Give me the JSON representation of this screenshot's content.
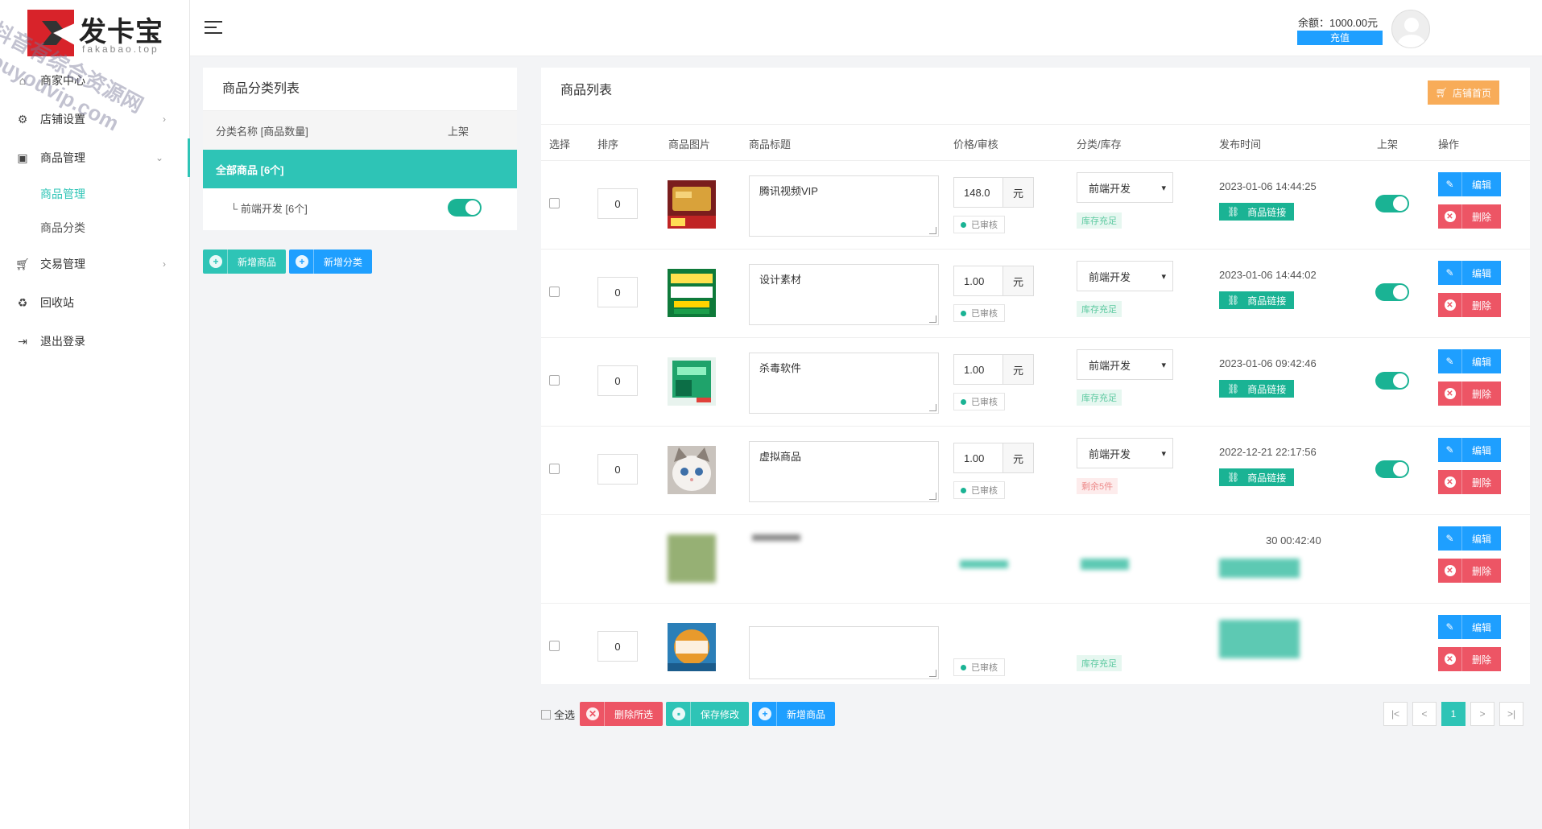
{
  "brand": {
    "name": "发卡宝",
    "domain": "fakabao.top"
  },
  "watermark": "抖音有综合资源网 douyouvip.com",
  "sidebar": {
    "items": [
      {
        "label": "商家中心",
        "icon": "home-icon"
      },
      {
        "label": "店铺设置",
        "icon": "gear-icon"
      },
      {
        "label": "商品管理",
        "icon": "bag-icon"
      },
      {
        "label": "交易管理",
        "icon": "cart-icon"
      },
      {
        "label": "回收站",
        "icon": "recycle-icon"
      },
      {
        "label": "退出登录",
        "icon": "logout-icon"
      }
    ],
    "sub_items": [
      {
        "label": "商品管理"
      },
      {
        "label": "商品分类"
      }
    ]
  },
  "topbar": {
    "balance": "余额：1000.00元",
    "recharge": "充值"
  },
  "category_panel": {
    "title": "商品分类列表",
    "col_name": "分类名称 [商品数量]",
    "col_online": "上架",
    "rows": [
      {
        "name": "全部商品 [6个]"
      },
      {
        "name": "└ 前端开发 [6个]"
      }
    ],
    "btn_add_goods": "新增商品",
    "btn_add_cat": "新增分类"
  },
  "product_panel": {
    "title": "商品列表",
    "shop_home": "店铺首页",
    "headers": [
      "选择",
      "排序",
      "商品图片",
      "商品标题",
      "价格/审核",
      "分类/库存",
      "发布时间",
      "上架",
      "操作"
    ],
    "unit": "元",
    "audited": "已审核",
    "link": "商品链接",
    "edit": "编辑",
    "delete": "删除",
    "rows": [
      {
        "sort": "0",
        "title": "腾讯视频VIP",
        "price": "148.0",
        "category": "前端开发",
        "stock": "库存充足",
        "time": "2023-01-06 14:44:25"
      },
      {
        "sort": "0",
        "title": "设计素材",
        "price": "1.00",
        "category": "前端开发",
        "stock": "库存充足",
        "time": "2023-01-06 14:44:02"
      },
      {
        "sort": "0",
        "title": "杀毒软件",
        "price": "1.00",
        "category": "前端开发",
        "stock": "库存充足",
        "time": "2023-01-06 09:42:46"
      },
      {
        "sort": "0",
        "title": "虚拟商品",
        "price": "1.00",
        "category": "前端开发",
        "stock": "剩余5件",
        "time": "2022-12-21 22:17:56"
      },
      {
        "time": "30 00:42:40"
      },
      {
        "sort": "0",
        "stock": "库存充足"
      }
    ]
  },
  "footer": {
    "select_all": "全选",
    "delete_selected": "删除所选",
    "save": "保存修改",
    "add_goods": "新增商品",
    "pages": [
      "|<",
      "<",
      "1",
      ">",
      ">|"
    ]
  },
  "colors": {
    "accent": "#2ec4b6",
    "blue": "#1e9fff",
    "red": "#ed5565",
    "green": "#1ab394",
    "orange": "#f8ac59"
  }
}
